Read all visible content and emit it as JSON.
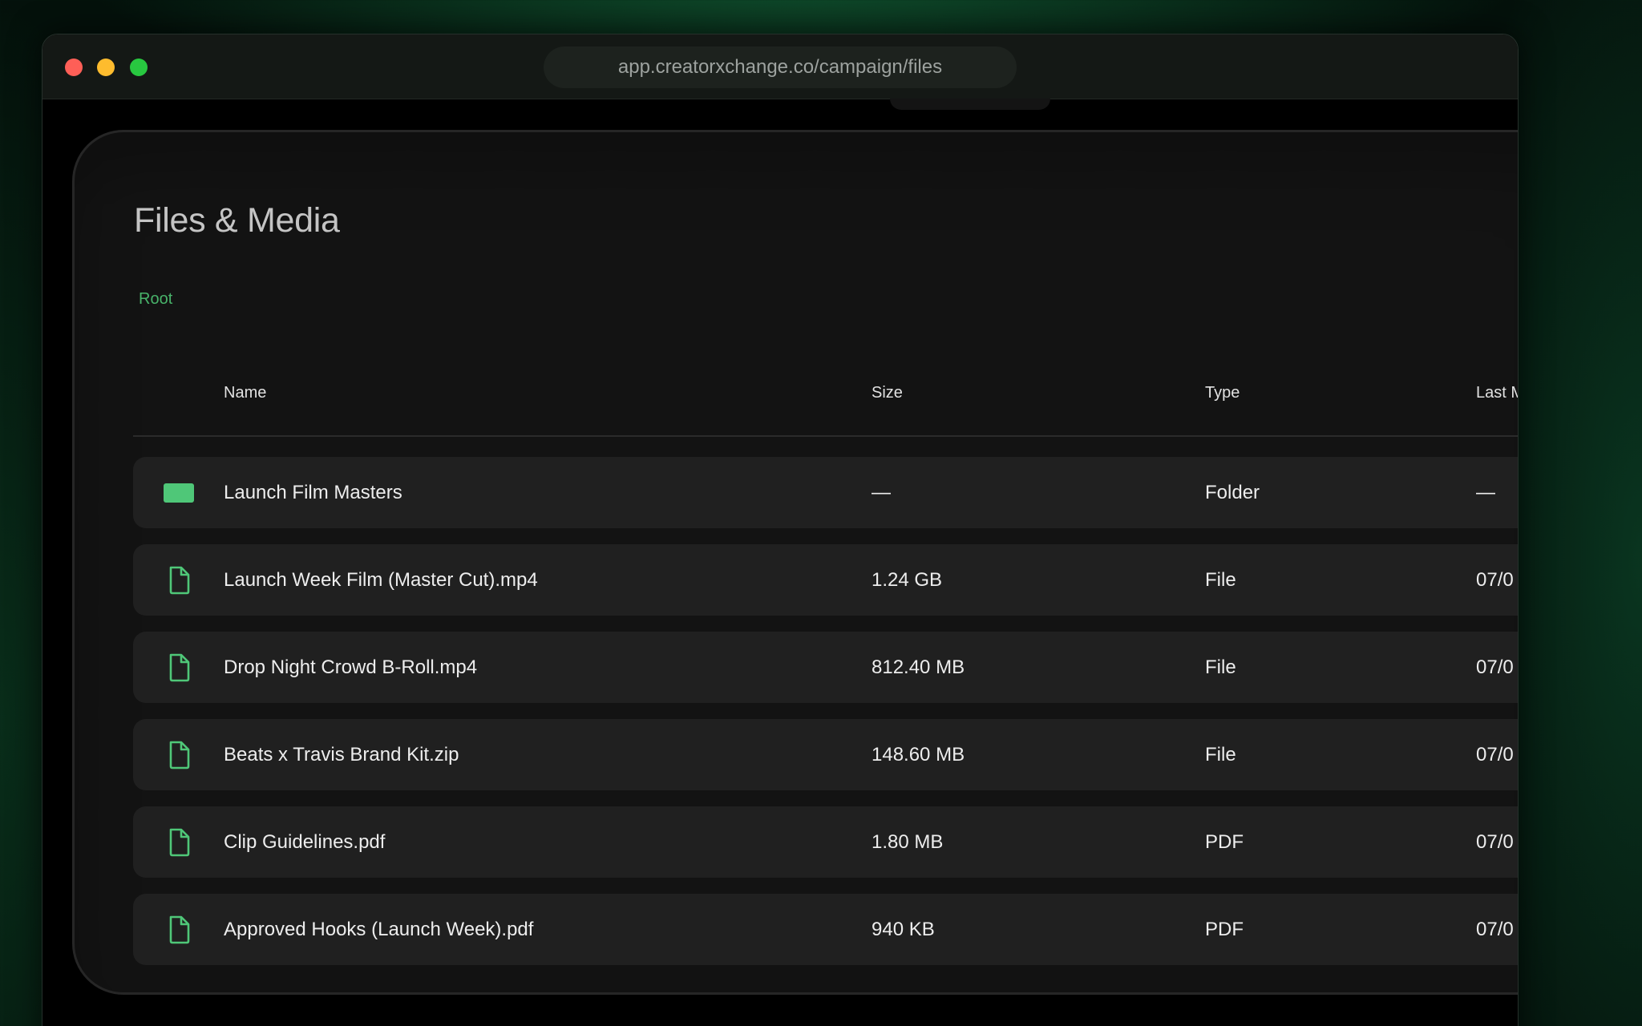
{
  "browser": {
    "url": "app.creatorxchange.co/campaign/files"
  },
  "colors": {
    "accent": "#48b36a",
    "panel_bg": "#131313",
    "row_bg": "#202020"
  },
  "page": {
    "title": "Files & Media",
    "breadcrumb": "Root"
  },
  "table": {
    "columns": [
      "Name",
      "Size",
      "Type",
      "Last M"
    ],
    "rows": [
      {
        "icon": "folder-icon",
        "name": "Launch Film Masters",
        "size": "—",
        "type": "Folder",
        "modified": "—"
      },
      {
        "icon": "file-icon",
        "name": "Launch Week Film (Master Cut).mp4",
        "size": "1.24 GB",
        "type": "File",
        "modified": "07/0"
      },
      {
        "icon": "file-icon",
        "name": "Drop Night Crowd B-Roll.mp4",
        "size": "812.40 MB",
        "type": "File",
        "modified": "07/0"
      },
      {
        "icon": "file-icon",
        "name": "Beats x Travis Brand Kit.zip",
        "size": "148.60 MB",
        "type": "File",
        "modified": "07/0"
      },
      {
        "icon": "file-icon",
        "name": "Clip Guidelines.pdf",
        "size": "1.80 MB",
        "type": "PDF",
        "modified": "07/0"
      },
      {
        "icon": "file-icon",
        "name": "Approved Hooks (Launch Week).pdf",
        "size": "940 KB",
        "type": "PDF",
        "modified": "07/0"
      }
    ]
  }
}
